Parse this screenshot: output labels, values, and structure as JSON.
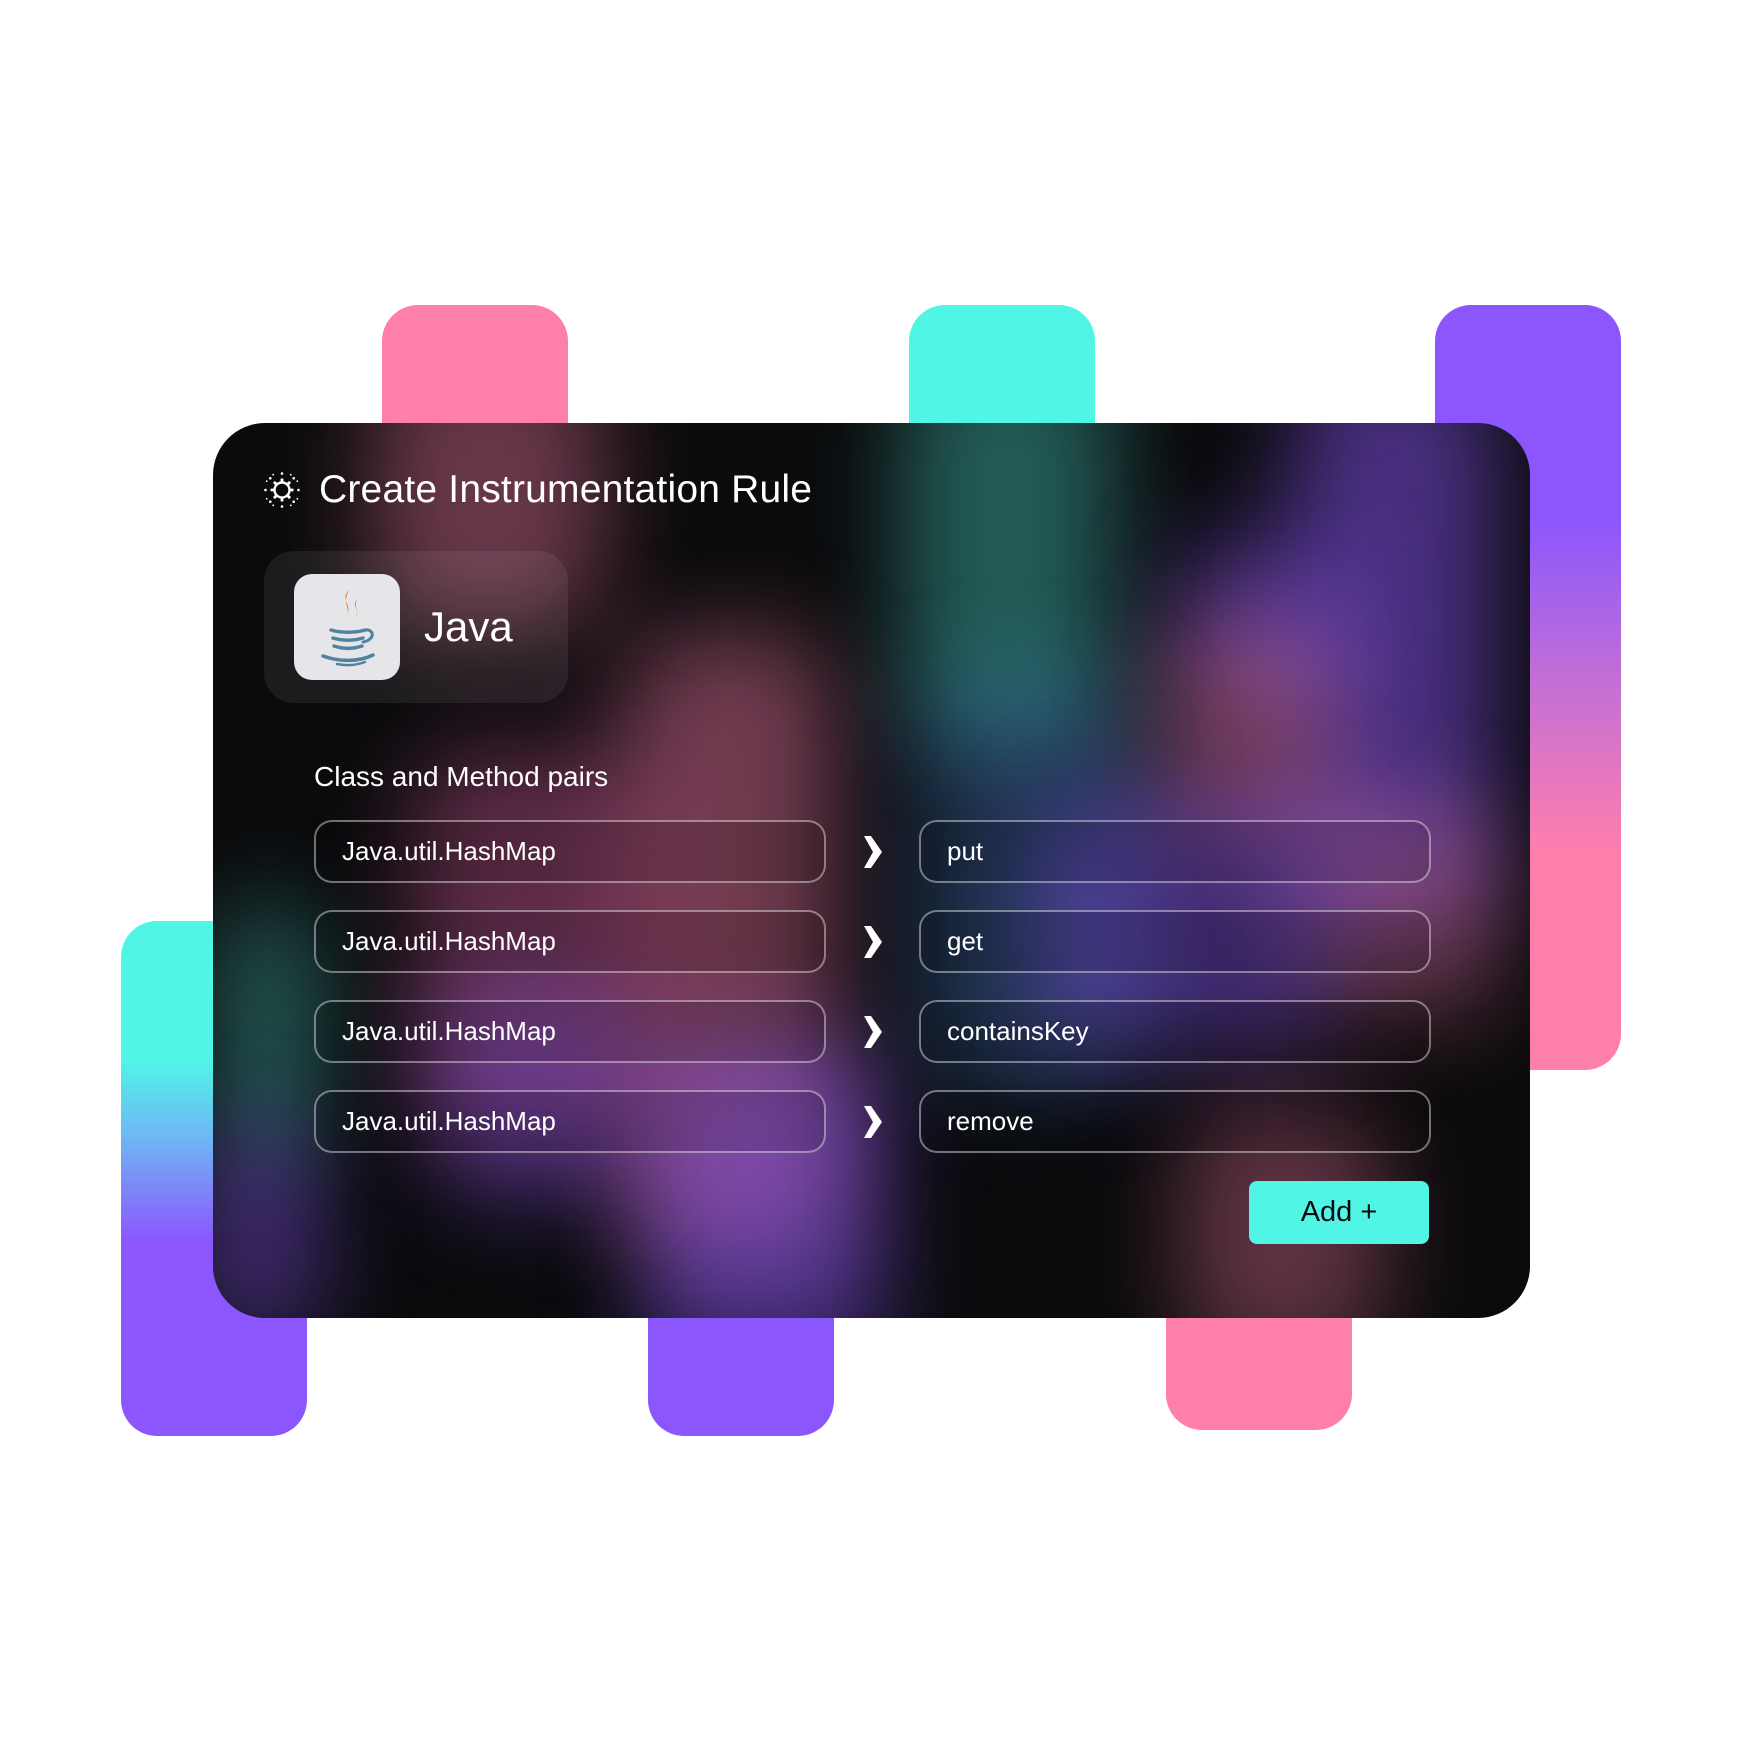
{
  "rule_editor": {
    "title": "Create Instrumentation Rule",
    "language": {
      "name": "Java",
      "logo_icon": "java-coffee-cup-icon"
    },
    "pairs_label": "Class and Method pairs",
    "pairs": [
      {
        "class_name": "Java.util.HashMap",
        "method": "put"
      },
      {
        "class_name": "Java.util.HashMap",
        "method": "get"
      },
      {
        "class_name": "Java.util.HashMap",
        "method": "containsKey"
      },
      {
        "class_name": "Java.util.HashMap",
        "method": "remove"
      }
    ],
    "add_label": "Add +"
  },
  "colors": {
    "pink": "#ff7fab",
    "cyan": "#50f5e6",
    "purple": "#8b57fd",
    "card_background": "#0b0b0d",
    "button": "#50f5e6"
  }
}
